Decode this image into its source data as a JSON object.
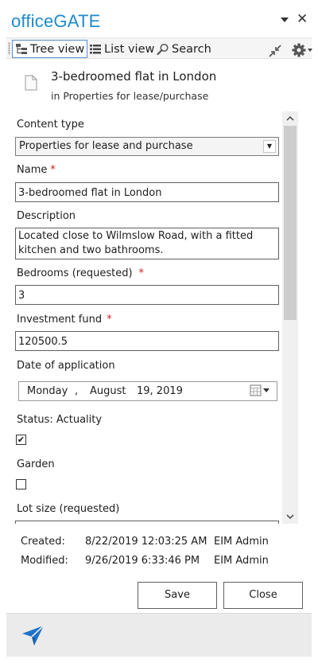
{
  "app": {
    "title": "officeGATE"
  },
  "toolbar": {
    "tree_view": "Tree view",
    "list_view": "List view",
    "search": "Search"
  },
  "document": {
    "title": "3-bedroomed flat in London",
    "location": "in Properties for lease/purchase"
  },
  "form": {
    "content_type": {
      "label": "Content type",
      "value": "Properties for lease and purchase"
    },
    "name": {
      "label": "Name",
      "required_mark": "*",
      "value": "3-bedroomed flat in London"
    },
    "description": {
      "label": "Description",
      "value": "Located close to Wilmslow Road, with a fitted kitchen and two bathrooms."
    },
    "bedrooms": {
      "label": "Bedrooms (requested)",
      "required_mark": "*",
      "value": "3"
    },
    "investment_fund": {
      "label": "Investment fund",
      "required_mark": "*",
      "value": "120500.5"
    },
    "date_of_application": {
      "label": "Date of application",
      "weekday": "Monday",
      "sep": ",",
      "month": "August",
      "day_year": "19, 2019"
    },
    "status_actuality": {
      "label": "Status: Actuality",
      "checked": true,
      "mark": "✔"
    },
    "garden": {
      "label": "Garden",
      "checked": false
    },
    "lot_size": {
      "label": "Lot size (requested)"
    }
  },
  "meta": {
    "created_label": "Created:",
    "created_date": "8/22/2019 12:03:25 AM",
    "created_by": "EIM Admin",
    "modified_label": "Modified:",
    "modified_date": "9/26/2019 6:33:46 PM",
    "modified_by": "EIM Admin"
  },
  "buttons": {
    "save": "Save",
    "close": "Close"
  },
  "icons": {
    "pane_menu": "triangle-down-icon",
    "close": "close-icon",
    "tree_view": "tree-view-icon",
    "list_view": "list-view-icon",
    "search": "magnifier-icon",
    "collapse": "collapse-arrows-icon",
    "settings": "gear-icon",
    "document": "document-icon",
    "calendar": "calendar-icon",
    "send": "paper-plane-icon"
  },
  "colors": {
    "brand": "#1e8bcd",
    "required": "#d21d1d",
    "active_border": "#5a8fc7",
    "send_icon": "#1e73c8"
  }
}
